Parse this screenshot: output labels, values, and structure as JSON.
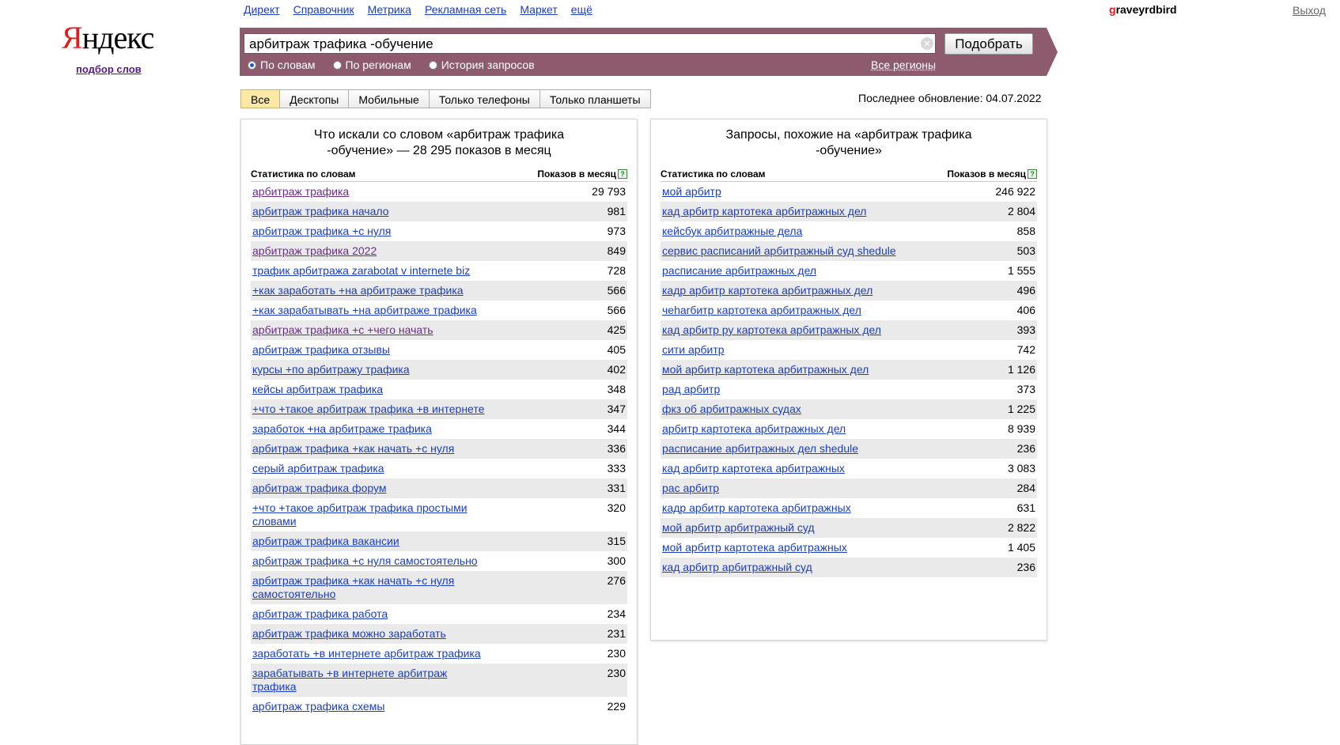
{
  "logo": {
    "first_letter": "Я",
    "rest": "ндекс",
    "subtitle": "подбор слов"
  },
  "topnav": [
    "Директ",
    "Справочник",
    "Метрика",
    "Рекламная сеть",
    "Маркет",
    "ещё"
  ],
  "user": {
    "first_letter": "g",
    "rest": "raveyrdbird",
    "logout": "Выход"
  },
  "search": {
    "value": "арбитраж трафика -обучение",
    "button": "Подобрать",
    "clear_icon": "×"
  },
  "radios": [
    {
      "label": "По словам",
      "checked": true
    },
    {
      "label": "По регионам",
      "checked": false
    },
    {
      "label": "История запросов",
      "checked": false
    }
  ],
  "all_regions": "Все регионы",
  "tabs": [
    {
      "label": "Все",
      "active": true
    },
    {
      "label": "Десктопы",
      "active": false
    },
    {
      "label": "Мобильные",
      "active": false
    },
    {
      "label": "Только телефоны",
      "active": false
    },
    {
      "label": "Только планшеты",
      "active": false
    }
  ],
  "last_update": "Последнее обновление: 04.07.2022",
  "left_panel": {
    "title": "Что искали со словом «арбитраж трафика -обучение» — 28 295 показов в месяц",
    "col_left": "Статистика по словам",
    "col_right": "Показов в месяц",
    "help": "?",
    "rows": [
      {
        "q": "арбитраж трафика",
        "n": "29 793",
        "visited": true
      },
      {
        "q": "арбитраж трафика начало",
        "n": "981"
      },
      {
        "q": "арбитраж трафика +с нуля",
        "n": "973"
      },
      {
        "q": "арбитраж трафика 2022",
        "n": "849",
        "visited": true
      },
      {
        "q": "трафик арбитража zarabotat v internete biz",
        "n": "728"
      },
      {
        "q": "+как заработать +на арбитраже трафика",
        "n": "566"
      },
      {
        "q": "+как зарабатывать +на арбитраже трафика",
        "n": "566"
      },
      {
        "q": "арбитраж трафика +с +чего начать",
        "n": "425",
        "visited": true
      },
      {
        "q": "арбитраж трафика отзывы",
        "n": "405"
      },
      {
        "q": "курсы +по арбитражу трафика",
        "n": "402"
      },
      {
        "q": "кейсы арбитраж трафика",
        "n": "348"
      },
      {
        "q": "+что +такое арбитраж трафика +в интернете",
        "n": "347"
      },
      {
        "q": "заработок +на арбитраже трафика",
        "n": "344"
      },
      {
        "q": "арбитраж трафика +как начать +с нуля",
        "n": "336"
      },
      {
        "q": "серый арбитраж трафика",
        "n": "333"
      },
      {
        "q": "арбитраж трафика форум",
        "n": "331"
      },
      {
        "q": "+что +такое арбитраж трафика простыми словами",
        "n": "320"
      },
      {
        "q": "арбитраж трафика вакансии",
        "n": "315"
      },
      {
        "q": "арбитраж трафика +с нуля самостоятельно",
        "n": "300"
      },
      {
        "q": "арбитраж трафика +как начать +с нуля самостоятельно",
        "n": "276"
      },
      {
        "q": "арбитраж трафика работа",
        "n": "234"
      },
      {
        "q": "арбитраж трафика можно заработать",
        "n": "231"
      },
      {
        "q": "заработать +в интернете арбитраж трафика",
        "n": "230"
      },
      {
        "q": "зарабатывать +в интернете арбитраж трафика",
        "n": "230"
      },
      {
        "q": "арбитраж трафика схемы",
        "n": "229"
      }
    ]
  },
  "right_panel": {
    "title": "Запросы, похожие на «арбитраж трафика -обучение»",
    "col_left": "Статистика по словам",
    "col_right": "Показов в месяц",
    "help": "?",
    "rows": [
      {
        "q": "мой арбитр",
        "n": "246 922"
      },
      {
        "q": "кад арбитр картотека арбитражных дел",
        "n": "2 804"
      },
      {
        "q": "кейсбук арбитражные дела",
        "n": "858"
      },
      {
        "q": "сервис расписаний арбитражный суд shedule",
        "n": "503"
      },
      {
        "q": "расписание арбитражных дел",
        "n": "1 555"
      },
      {
        "q": "кадр арбитр картотека арбитражных дел",
        "n": "496"
      },
      {
        "q": "чеharбитр картотека арбитражных дел",
        "n": "406"
      },
      {
        "q": "кад арбитр ру картотека арбитражных дел",
        "n": "393"
      },
      {
        "q": "сити арбитр",
        "n": "742"
      },
      {
        "q": "мой арбитр картотека арбитражных дел",
        "n": "1 126"
      },
      {
        "q": "рад арбитр",
        "n": "373"
      },
      {
        "q": "фкз об арбитражных судах",
        "n": "1 225"
      },
      {
        "q": "арбитр картотека арбитражных дел",
        "n": "8 939"
      },
      {
        "q": "расписание арбитражных дел shedule",
        "n": "236"
      },
      {
        "q": "кад арбитр картотека арбитражных",
        "n": "3 083"
      },
      {
        "q": "рас арбитр",
        "n": "284"
      },
      {
        "q": "кадр арбитр картотека арбитражных",
        "n": "631"
      },
      {
        "q": "мой арбитр арбитражный суд",
        "n": "2 822"
      },
      {
        "q": "мой арбитр картотека арбитражных",
        "n": "1 405"
      },
      {
        "q": "кад арбитр арбитражный суд",
        "n": "236"
      }
    ]
  }
}
